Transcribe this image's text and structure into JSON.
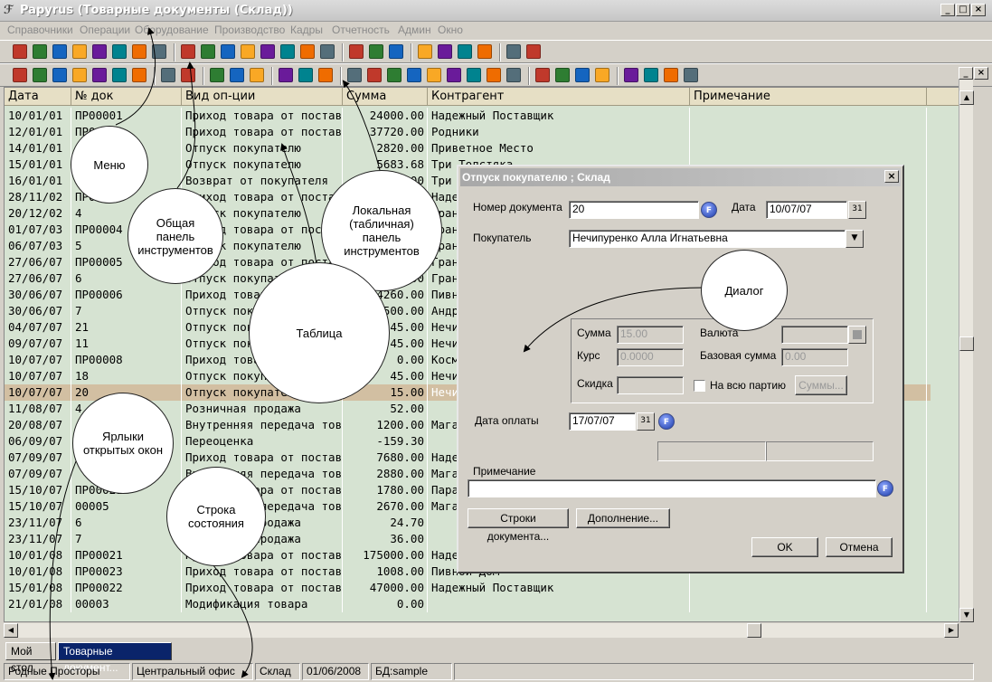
{
  "window": {
    "title": "Papyrus (Товарные документы (Склад))"
  },
  "menu": [
    "Справочники",
    "Операции",
    "Оборудование",
    "Производство",
    "Кадры",
    "Отчетность",
    "Админ",
    "Окно"
  ],
  "grid": {
    "columns": [
      "Дата",
      "№ док",
      "Вид оп-ции",
      "Сумма",
      "Контрагент",
      "Примечание"
    ],
    "rows": [
      [
        "10/01/01",
        "ПР00001",
        "Приход товара от постав",
        "24000.00",
        "Надежный Поставщик"
      ],
      [
        "12/01/01",
        "ПР00002",
        "Приход товара от постав",
        "37720.00",
        "Родники"
      ],
      [
        "14/01/01",
        "1",
        "Отпуск покупателю",
        "2820.00",
        "Приветное Место"
      ],
      [
        "15/01/01",
        "2",
        "Отпуск покупателю",
        "5683.68",
        "Три Толстяка"
      ],
      [
        "16/01/01",
        "3",
        "Возврат от покупателя",
        "60.00",
        "Три Толстяка"
      ],
      [
        "28/11/02",
        "ПР00003",
        "Приход товара от постав",
        "1800.00",
        "Надежный Поставщик"
      ],
      [
        "20/12/02",
        "4",
        "Отпуск покупателю",
        "35.00",
        "Гранд"
      ],
      [
        "01/07/03",
        "ПР00004",
        "Приход товара от постав",
        "3000.00",
        "Гранд"
      ],
      [
        "06/07/03",
        "5",
        "Отпуск покупателю",
        "60.00",
        "Гранд"
      ],
      [
        "27/06/07",
        "ПР00005",
        "Приход товара от постав",
        "2000.00",
        "Гранд"
      ],
      [
        "27/06/07",
        "6",
        "Отпуск покупателю",
        "50.00",
        "Гранд"
      ],
      [
        "30/06/07",
        "ПР00006",
        "Приход товара от постав",
        "4260.00",
        "Пивной Дом"
      ],
      [
        "30/06/07",
        "7",
        "Отпуск покупателю",
        "500.00",
        "Андреев"
      ],
      [
        "04/07/07",
        "21",
        "Отпуск покупателю",
        "45.00",
        "Нечипуренко"
      ],
      [
        "09/07/07",
        "11",
        "Отпуск покупателю",
        "45.00",
        "Нечипуренко"
      ],
      [
        "10/07/07",
        "ПР00008",
        "Приход товара от постав",
        "0.00",
        "Космос"
      ],
      [
        "10/07/07",
        "18",
        "Отпуск покупателю",
        "45.00",
        "Нечипуренко"
      ],
      [
        "10/07/07",
        "20",
        "Отпуск покупателю",
        "15.00",
        "Нечипуренко"
      ],
      [
        "11/08/07",
        "4",
        "Розничная продажа",
        "52.00",
        ""
      ],
      [
        "20/08/07",
        "",
        "Внутренняя передача тов",
        "1200.00",
        "Магазин"
      ],
      [
        "06/09/07",
        "",
        "Переоценка",
        "-159.30",
        ""
      ],
      [
        "07/09/07",
        "",
        "Приход товара от постав",
        "7680.00",
        "Надежный Поставщик"
      ],
      [
        "07/09/07",
        "",
        "Внутренняя передача тов",
        "2880.00",
        "Магазин"
      ],
      [
        "15/10/07",
        "ПР00021",
        "Приход товара от постав",
        "1780.00",
        "Парадиз"
      ],
      [
        "15/10/07",
        "00005",
        "Внутренняя передача тов",
        "2670.00",
        "Магазин"
      ],
      [
        "23/11/07",
        "6",
        "Розничная продажа",
        "24.70",
        ""
      ],
      [
        "23/11/07",
        "7",
        "Розничная продажа",
        "36.00",
        ""
      ],
      [
        "10/01/08",
        "ПР00021",
        "Приход товара от постав",
        "175000.00",
        "Надежный Поставщик"
      ],
      [
        "10/01/08",
        "ПР00023",
        "Приход товара от постав",
        "1008.00",
        "Пивной Дом"
      ],
      [
        "15/01/08",
        "ПР00022",
        "Приход товара от постав",
        "47000.00",
        "Надежный Поставщик"
      ],
      [
        "21/01/08",
        "00003",
        "Модификация товара",
        "0.00",
        ""
      ]
    ],
    "selected_row": 17
  },
  "tabs": [
    "Мой стол",
    "Товарные документ..."
  ],
  "status": [
    "Родные Просторы",
    "Центральный офис",
    "Склад",
    "01/06/2008",
    "БД:sample"
  ],
  "dialog": {
    "title": "Отпуск покупателю ; Склад",
    "doc_number_label": "Номер документа",
    "doc_number": "20",
    "date_label": "Дата",
    "date": "10/07/07",
    "buyer_label": "Покупатель",
    "buyer": "Нечипуренко Алла Игнатьевна",
    "sum_label": "Сумма",
    "sum": "15.00",
    "currency_label": "Валюта",
    "rate_label": "Курс",
    "rate": "0.0000",
    "base_sum_label": "Базовая сумма",
    "base_sum": "0.00",
    "discount_label": "Скидка",
    "whole_batch_label": "На всю партию",
    "sums_button": "Суммы...",
    "pay_date_label": "Дата оплаты",
    "pay_date": "17/07/07",
    "note_label": "Примечание",
    "doc_rows_button": "Строки документа...",
    "extra_button": "Дополнение...",
    "ok_button": "OK",
    "cancel_button": "Отмена",
    "cal_label": "31",
    "f_label": "F"
  },
  "callouts": {
    "menu": "Меню",
    "common_toolbar": "Общая панель инструментов",
    "local_toolbar": "Локальная (табличная) панель инструментов",
    "dialog": "Диалог",
    "table": "Таблица",
    "window_tabs": "Ярлыки открытых окон",
    "status_bar": "Строка состояния"
  },
  "toolbar1_icons": [
    "goods-icon",
    "doc-icon",
    "building-icon",
    "mail-icon",
    "print-icon",
    "copy-icon",
    "cart-icon",
    "globe-icon",
    "dc-icon",
    "text-icon",
    "doc2-icon",
    "doc3-icon",
    "doc4-icon",
    "doc5-icon",
    "arrows-icon",
    "book-icon",
    "pc-icon",
    "report-icon",
    "check-icon",
    "list-icon",
    "list2-icon",
    "list3-icon",
    "list4-icon",
    "tool-icon",
    "tool2-icon"
  ],
  "toolbar2_icons": [
    "props-icon",
    "add-icon",
    "copy-icon",
    "delete-icon",
    "delete-all-icon",
    "filter-icon",
    "tree-icon",
    "search-icon",
    "sort-icon",
    "recycle-icon",
    "sys-icon",
    "stack-icon",
    "link-icon",
    "calc-icon",
    "money-icon",
    "house-icon",
    "dollar-icon",
    "tree2-icon",
    "cluster-icon",
    "people-icon",
    "globe-icon",
    "transfer-icon",
    "tool-icon",
    "clip-icon",
    "print-icon",
    "print2-icon",
    "arrow-icon",
    "arrow2-icon",
    "sum-icon",
    "cross-icon",
    "transfer2-icon",
    "refresh-icon"
  ]
}
